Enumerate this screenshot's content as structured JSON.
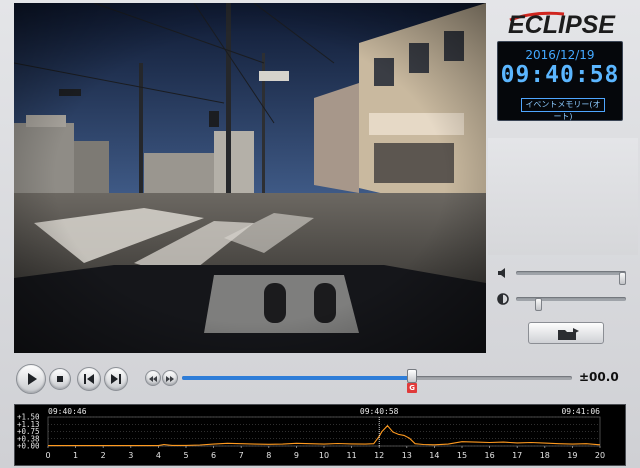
{
  "brand": {
    "name": "ECLIPSE"
  },
  "clock": {
    "date": "2016/12/19",
    "time": "09:40:58",
    "mode": "イベントメモリー(オート)"
  },
  "colors": {
    "accent": "#43a8ff",
    "seek": "#2e7dd8",
    "graph_line": "#ff9a1f",
    "gmark": "#e03a3a"
  },
  "controls": {
    "play_icon": "play-icon",
    "stop_icon": "stop-icon",
    "prev_icon": "skip-back-icon",
    "next_icon": "skip-forward-icon",
    "slow_icon": "rewind-icon",
    "fast_icon": "fast-forward-icon",
    "seek_progress": 0.59,
    "offset": "±00.0",
    "gmark_label": "G"
  },
  "volume": {
    "icon": "speaker-icon",
    "level": 1.0
  },
  "brightness": {
    "icon": "brightness-icon",
    "level": 0.18
  },
  "eject": {
    "icon": "eject-folder-icon"
  },
  "graph": {
    "timestamps": [
      {
        "label": "09:40:46",
        "sec": 0
      },
      {
        "label": "09:40:58",
        "sec": 12
      },
      {
        "label": "09:41:06",
        "sec": 20
      }
    ],
    "y_labels": [
      "+1.50",
      "+1.13",
      "+0.75",
      "+0.38",
      "+0.00"
    ],
    "x_ticks": [
      "0",
      "1",
      "2",
      "3",
      "4",
      "5",
      "6",
      "7",
      "8",
      "9",
      "10",
      "11",
      "12",
      "13",
      "14",
      "15",
      "16",
      "17",
      "18",
      "19",
      "20"
    ]
  },
  "chart_data": {
    "type": "line",
    "xlabel": "",
    "ylabel": "",
    "xlim": [
      0,
      20
    ],
    "ylim": [
      0,
      1.5
    ],
    "series": [
      {
        "x": [
          0,
          1,
          2,
          3,
          4,
          4.2,
          4.5,
          5,
          5.5,
          6,
          6.5,
          7,
          7.5,
          8,
          8.5,
          9,
          9.5,
          10,
          10.5,
          11,
          11.5,
          11.8,
          12,
          12.1,
          12.3,
          12.5,
          12.7,
          12.9,
          13.1,
          13.3,
          13.6,
          14,
          14.5,
          15,
          15.5,
          16,
          16.5,
          17,
          17.5,
          18,
          18.5,
          19,
          19.5,
          20
        ],
        "y": [
          0.02,
          0.02,
          0.02,
          0.02,
          0.02,
          0.08,
          0.03,
          0.03,
          0.05,
          0.1,
          0.14,
          0.12,
          0.1,
          0.09,
          0.1,
          0.14,
          0.12,
          0.1,
          0.13,
          0.11,
          0.1,
          0.12,
          0.5,
          0.75,
          1.05,
          0.72,
          0.6,
          0.55,
          0.4,
          0.12,
          0.08,
          0.06,
          0.1,
          0.22,
          0.2,
          0.18,
          0.2,
          0.16,
          0.18,
          0.15,
          0.12,
          0.1,
          0.12,
          0.06
        ]
      }
    ]
  }
}
